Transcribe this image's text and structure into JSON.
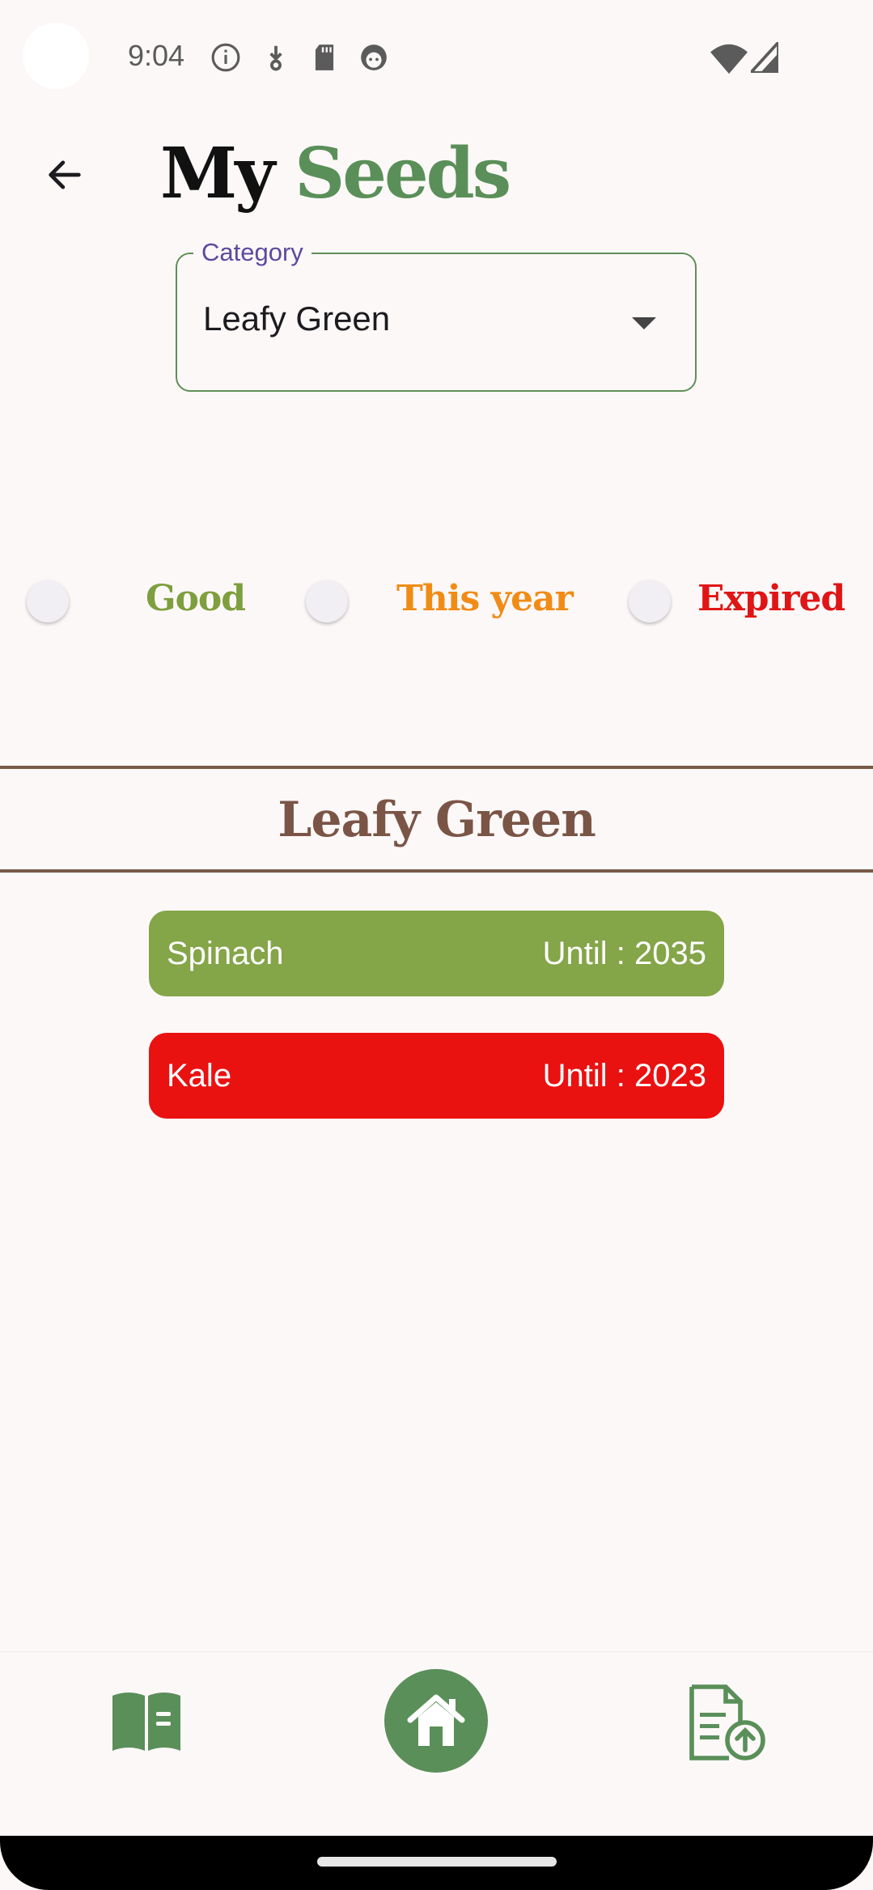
{
  "status_bar": {
    "time": "9:04",
    "icons": [
      "info-icon",
      "download-icon",
      "sd-card-icon",
      "face-icon",
      "wifi-icon",
      "signal-icon"
    ]
  },
  "header": {
    "back_icon": "arrow-back-icon",
    "title_part1": "My",
    "title_part2": "Seeds"
  },
  "category_dropdown": {
    "label": "Category",
    "value": "Leafy Green"
  },
  "filters": [
    {
      "label": "Good",
      "color": "#7e9f3e"
    },
    {
      "label": "This year",
      "color": "#f08c16"
    },
    {
      "label": "Expired",
      "color": "#e01515"
    }
  ],
  "section": {
    "title": "Leafy Green"
  },
  "seeds": [
    {
      "name": "Spinach",
      "until": "Until : 2035",
      "color": "#84a548"
    },
    {
      "name": "Kale",
      "until": "Until : 2023",
      "color": "#ea1111"
    }
  ],
  "bottom_nav": {
    "left_icon": "book-icon",
    "center_icon": "home-icon",
    "right_icon": "upload-document-icon",
    "accent": "#5a8f59"
  }
}
